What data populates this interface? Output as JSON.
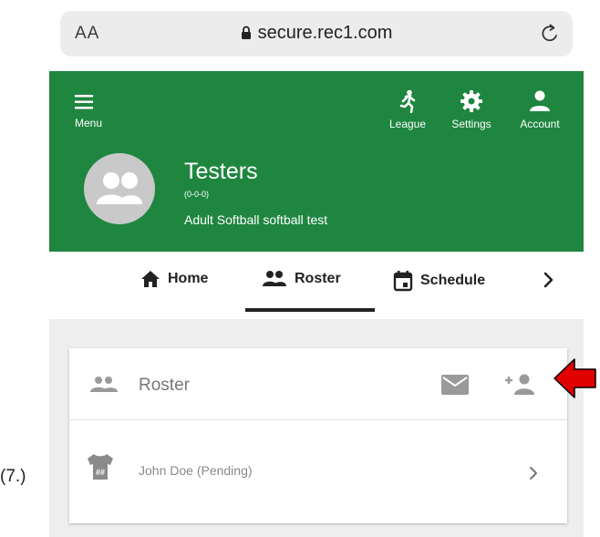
{
  "browser": {
    "aa_label": "AA",
    "url": "secure.rec1.com"
  },
  "header": {
    "menu_label": "Menu",
    "league_label": "League",
    "settings_label": "Settings",
    "account_label": "Account",
    "team_name": "Testers",
    "team_record": "(0-0-0)",
    "team_league": "Adult Softball softball test"
  },
  "tabs": [
    {
      "label": "Home"
    },
    {
      "label": "Roster"
    },
    {
      "label": "Schedule"
    }
  ],
  "roster_card": {
    "title": "Roster",
    "members": [
      {
        "name": "John Doe (Pending)"
      }
    ]
  },
  "annotation": {
    "step_label": "(7.)",
    "arrow_color": "#e00000"
  },
  "colors": {
    "brand_green": "#1f8640",
    "content_bg": "#eeeeee"
  }
}
